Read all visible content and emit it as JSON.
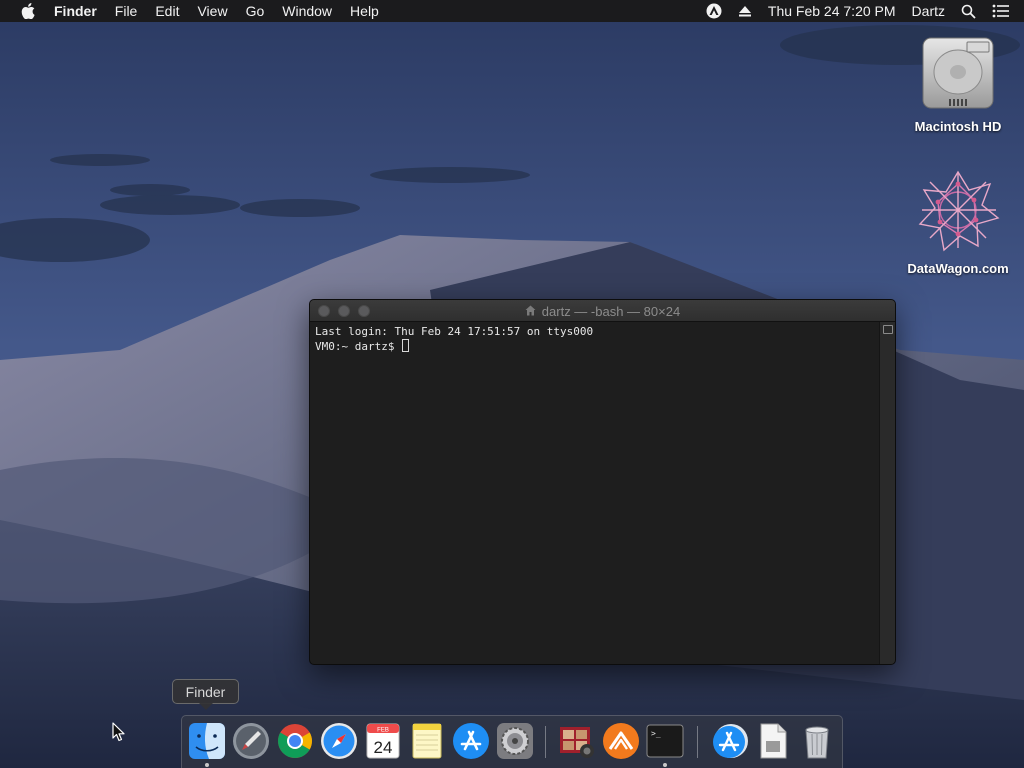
{
  "menubar": {
    "apple_icon": "apple-logo-icon",
    "app_name": "Finder",
    "menus": [
      "File",
      "Edit",
      "View",
      "Go",
      "Window",
      "Help"
    ],
    "status_icons": [
      "user-switch-icon",
      "eject-icon"
    ],
    "clock": "Thu Feb 24  7:20 PM",
    "user": "Dartz",
    "search_icon": "spotlight-search-icon",
    "notification_icon": "notification-center-icon"
  },
  "desktop": {
    "icons": [
      {
        "label": "Macintosh HD",
        "icon": "hard-drive-icon"
      },
      {
        "label": "DataWagon.com",
        "icon": "network-volume-icon"
      }
    ]
  },
  "terminal": {
    "title": "dartz — -bash — 80×24",
    "lines": [
      "Last login: Thu Feb 24 17:51:57 on ttys000",
      "VM0:~ dartz$ "
    ]
  },
  "tooltip": "Finder",
  "dock": {
    "apps": [
      {
        "name": "Finder",
        "icon": "finder-icon",
        "running": true
      },
      {
        "name": "Launchpad",
        "icon": "launchpad-icon",
        "running": false
      },
      {
        "name": "Google Chrome",
        "icon": "chrome-icon",
        "running": false
      },
      {
        "name": "Safari",
        "icon": "safari-icon",
        "running": false
      },
      {
        "name": "Calendar",
        "icon": "calendar-icon",
        "running": false,
        "month": "FEB",
        "day": "24"
      },
      {
        "name": "Notes",
        "icon": "notes-icon",
        "running": false
      },
      {
        "name": "App Store",
        "icon": "app-store-icon",
        "running": false
      },
      {
        "name": "System Preferences",
        "icon": "system-preferences-icon",
        "running": false
      },
      {
        "name": "Photo Booth",
        "icon": "photo-booth-icon",
        "running": false
      },
      {
        "name": "Sublime Merge",
        "icon": "merge-icon",
        "running": false
      },
      {
        "name": "Terminal",
        "icon": "terminal-icon",
        "running": true
      },
      {
        "name": "Downloads",
        "icon": "downloads-stack-icon",
        "running": false
      },
      {
        "name": "Documents",
        "icon": "document-stack-icon",
        "running": false
      },
      {
        "name": "Trash",
        "icon": "trash-icon",
        "running": false
      }
    ]
  },
  "colors": {
    "menubar_bg": "#1b1b1d",
    "terminal_bg": "#1e1e1e",
    "sky_top": "#2b3a62",
    "dune": "#4e5774"
  }
}
